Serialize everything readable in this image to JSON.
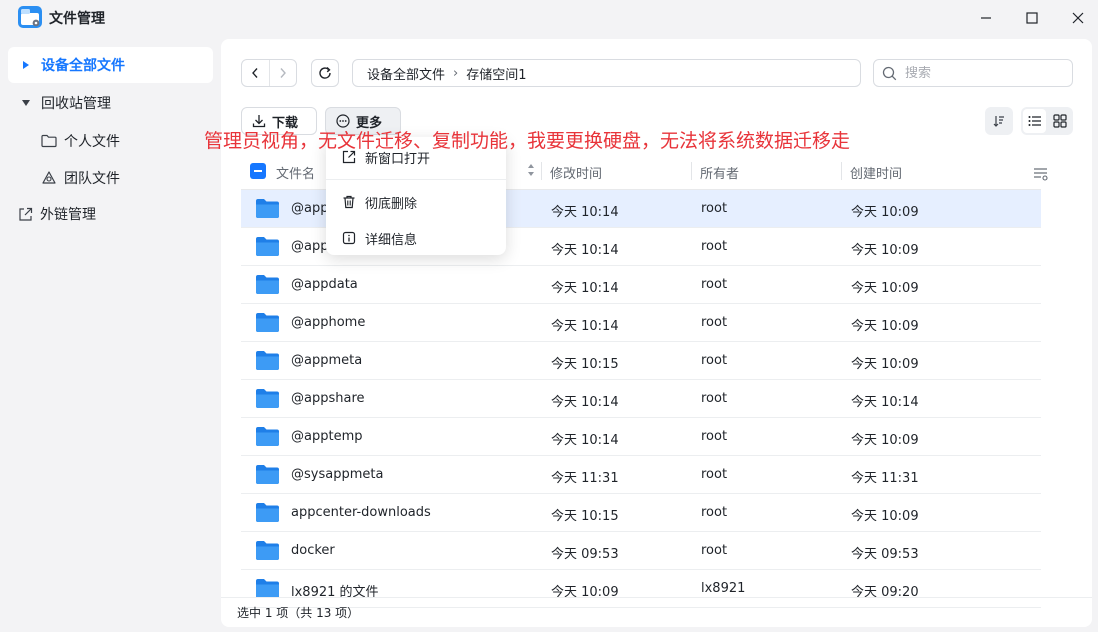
{
  "window": {
    "title": "文件管理",
    "controls": [
      "minimize-icon",
      "maximize-icon",
      "close-icon"
    ]
  },
  "sidebar": {
    "items": [
      {
        "label": "设备全部文件",
        "icon": "caret-right-icon",
        "active": true
      },
      {
        "label": "回收站管理",
        "icon": "caret-down-icon"
      },
      {
        "label": "个人文件",
        "icon": "folder-icon"
      },
      {
        "label": "团队文件",
        "icon": "team-icon"
      },
      {
        "label": "外链管理",
        "icon": "external-link-icon"
      }
    ]
  },
  "path": {
    "segments": [
      "设备全部文件",
      "存储空间1"
    ],
    "separator": "›"
  },
  "search": {
    "placeholder": "搜索"
  },
  "toolbar": {
    "download_label": "下载",
    "more_label": "更多"
  },
  "table": {
    "columns": [
      "文件名",
      "修改时间",
      "所有者",
      "创建时间"
    ],
    "rows": [
      {
        "name": "@app",
        "modified": "今天 10:14",
        "owner": "root",
        "created": "今天 10:09",
        "selected": true
      },
      {
        "name": "@app",
        "modified": "今天 10:14",
        "owner": "root",
        "created": "今天 10:09"
      },
      {
        "name": "@appdata",
        "modified": "今天 10:14",
        "owner": "root",
        "created": "今天 10:09"
      },
      {
        "name": "@apphome",
        "modified": "今天 10:14",
        "owner": "root",
        "created": "今天 10:09"
      },
      {
        "name": "@appmeta",
        "modified": "今天 10:15",
        "owner": "root",
        "created": "今天 10:09"
      },
      {
        "name": "@appshare",
        "modified": "今天 10:14",
        "owner": "root",
        "created": "今天 10:14"
      },
      {
        "name": "@apptemp",
        "modified": "今天 10:14",
        "owner": "root",
        "created": "今天 10:09"
      },
      {
        "name": "@sysappmeta",
        "modified": "今天 11:31",
        "owner": "root",
        "created": "今天 11:31"
      },
      {
        "name": "appcenter-downloads",
        "modified": "今天 10:15",
        "owner": "root",
        "created": "今天 10:09"
      },
      {
        "name": "docker",
        "modified": "今天 09:53",
        "owner": "root",
        "created": "今天 09:53"
      },
      {
        "name": "lx8921 的文件",
        "modified": "今天 10:09",
        "owner": "lx8921",
        "created": "今天 09:20"
      }
    ]
  },
  "context_menu": {
    "items": [
      {
        "label": "新窗口打开",
        "icon": "open-new-window-icon"
      },
      {
        "label": "彻底删除",
        "icon": "trash-icon"
      },
      {
        "label": "详细信息",
        "icon": "info-icon"
      }
    ]
  },
  "status": {
    "selection": "选中 1 项（共 13 项）"
  },
  "annotation": {
    "text": "管理员视角，无文件迁移、复制功能，我要更换硬盘，无法将系统数据迁移走"
  },
  "colors": {
    "accent": "#1677ff",
    "annotation": "#e8343a",
    "selected_row": "#e6efff",
    "folder": "#2b8ff2"
  }
}
